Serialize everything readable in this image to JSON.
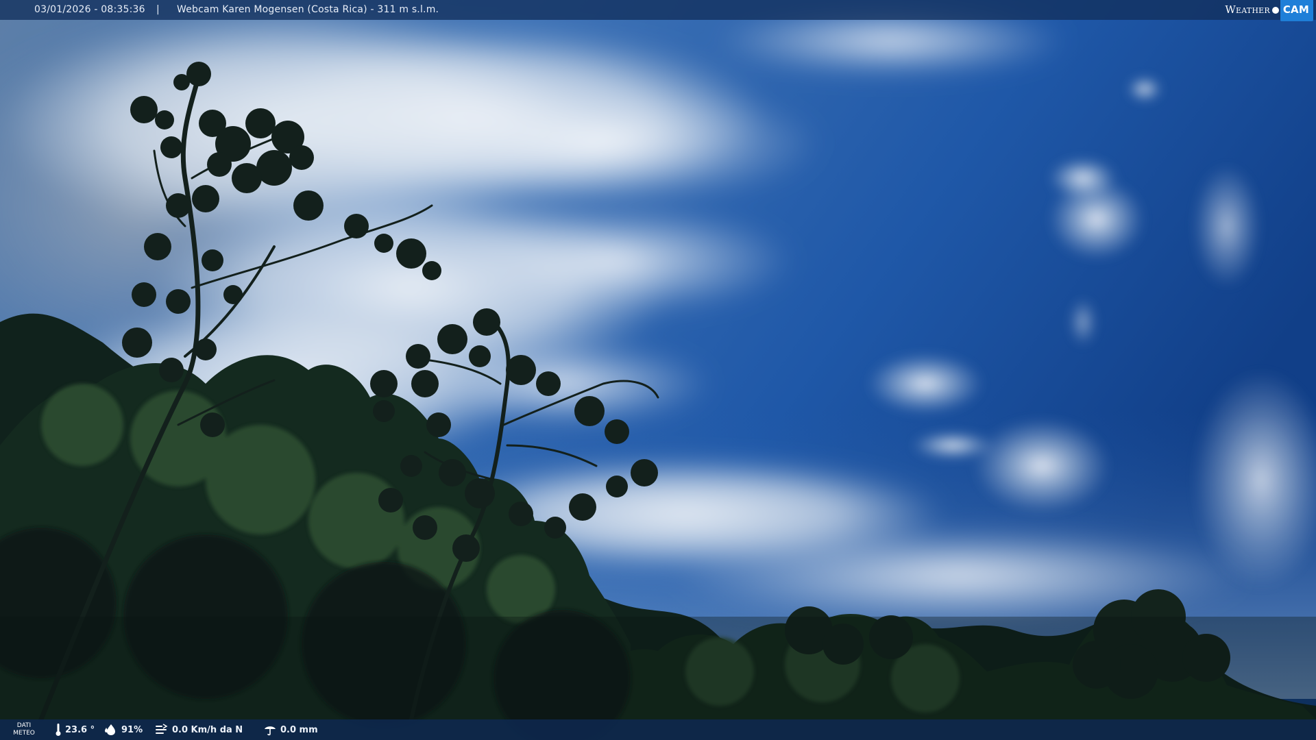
{
  "overlay_top": {
    "datetime": "03/01/2026 - 08:35:36",
    "separator": "|",
    "camera_title": "Webcam Karen Mogensen (Costa Rica)  - 311 m s.l.m."
  },
  "logo": {
    "word1": "Weather",
    "word2": "CAM"
  },
  "overlay_bottom": {
    "label_line1": "DATI",
    "label_line2": "METEO",
    "temperature": "23.6 °",
    "humidity": "91%",
    "wind": "0.0 Km/h da N",
    "rain": "0.0 mm"
  },
  "icons": [
    "thermometer-icon",
    "humidity-icon",
    "wind-icon",
    "rain-icon",
    "logo-dot-icon"
  ],
  "colors": {
    "sky_top": "#0f3f86",
    "sky_mid": "#2f6cb8",
    "cloud": "#e9eef5",
    "foliage_dark": "#0d1a17",
    "foliage_mid": "#23402a",
    "bar_blue": "#12305c",
    "logo_blue": "#1f7fd8"
  }
}
